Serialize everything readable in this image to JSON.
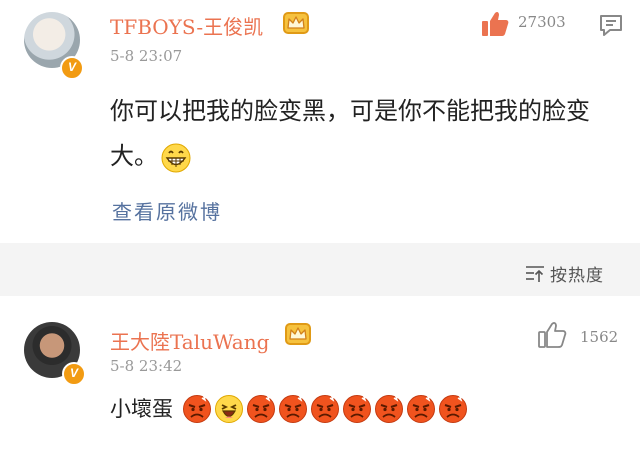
{
  "post": {
    "author": "TFBOYS-王俊凯",
    "time": "5-8 23:07",
    "likes": "27303",
    "text": "你可以把我的脸变黑，可是你不能把我的脸变大。",
    "emoji": "grinning-face",
    "view_original": "查看原微博",
    "verified_badge": "V",
    "icons": {
      "like": "thumbs-up-icon",
      "message": "message-icon",
      "crown": "crown-badge-icon"
    }
  },
  "sort": {
    "label": "按热度",
    "icon": "sort-icon"
  },
  "reply": {
    "author": "王大陸TaluWang",
    "time": "5-8 23:42",
    "likes": "1562",
    "text": "小壞蛋",
    "verified_badge": "V",
    "emojis": [
      "angry-face",
      "laughing-face",
      "angry-face",
      "angry-face",
      "angry-face",
      "angry-face",
      "angry-face",
      "angry-face",
      "angry-face"
    ]
  },
  "colors": {
    "name": "#eb7350",
    "link": "#56729f",
    "like_active": "#eb7350",
    "badge": "#f29b12",
    "background": "#f4f4f4"
  }
}
